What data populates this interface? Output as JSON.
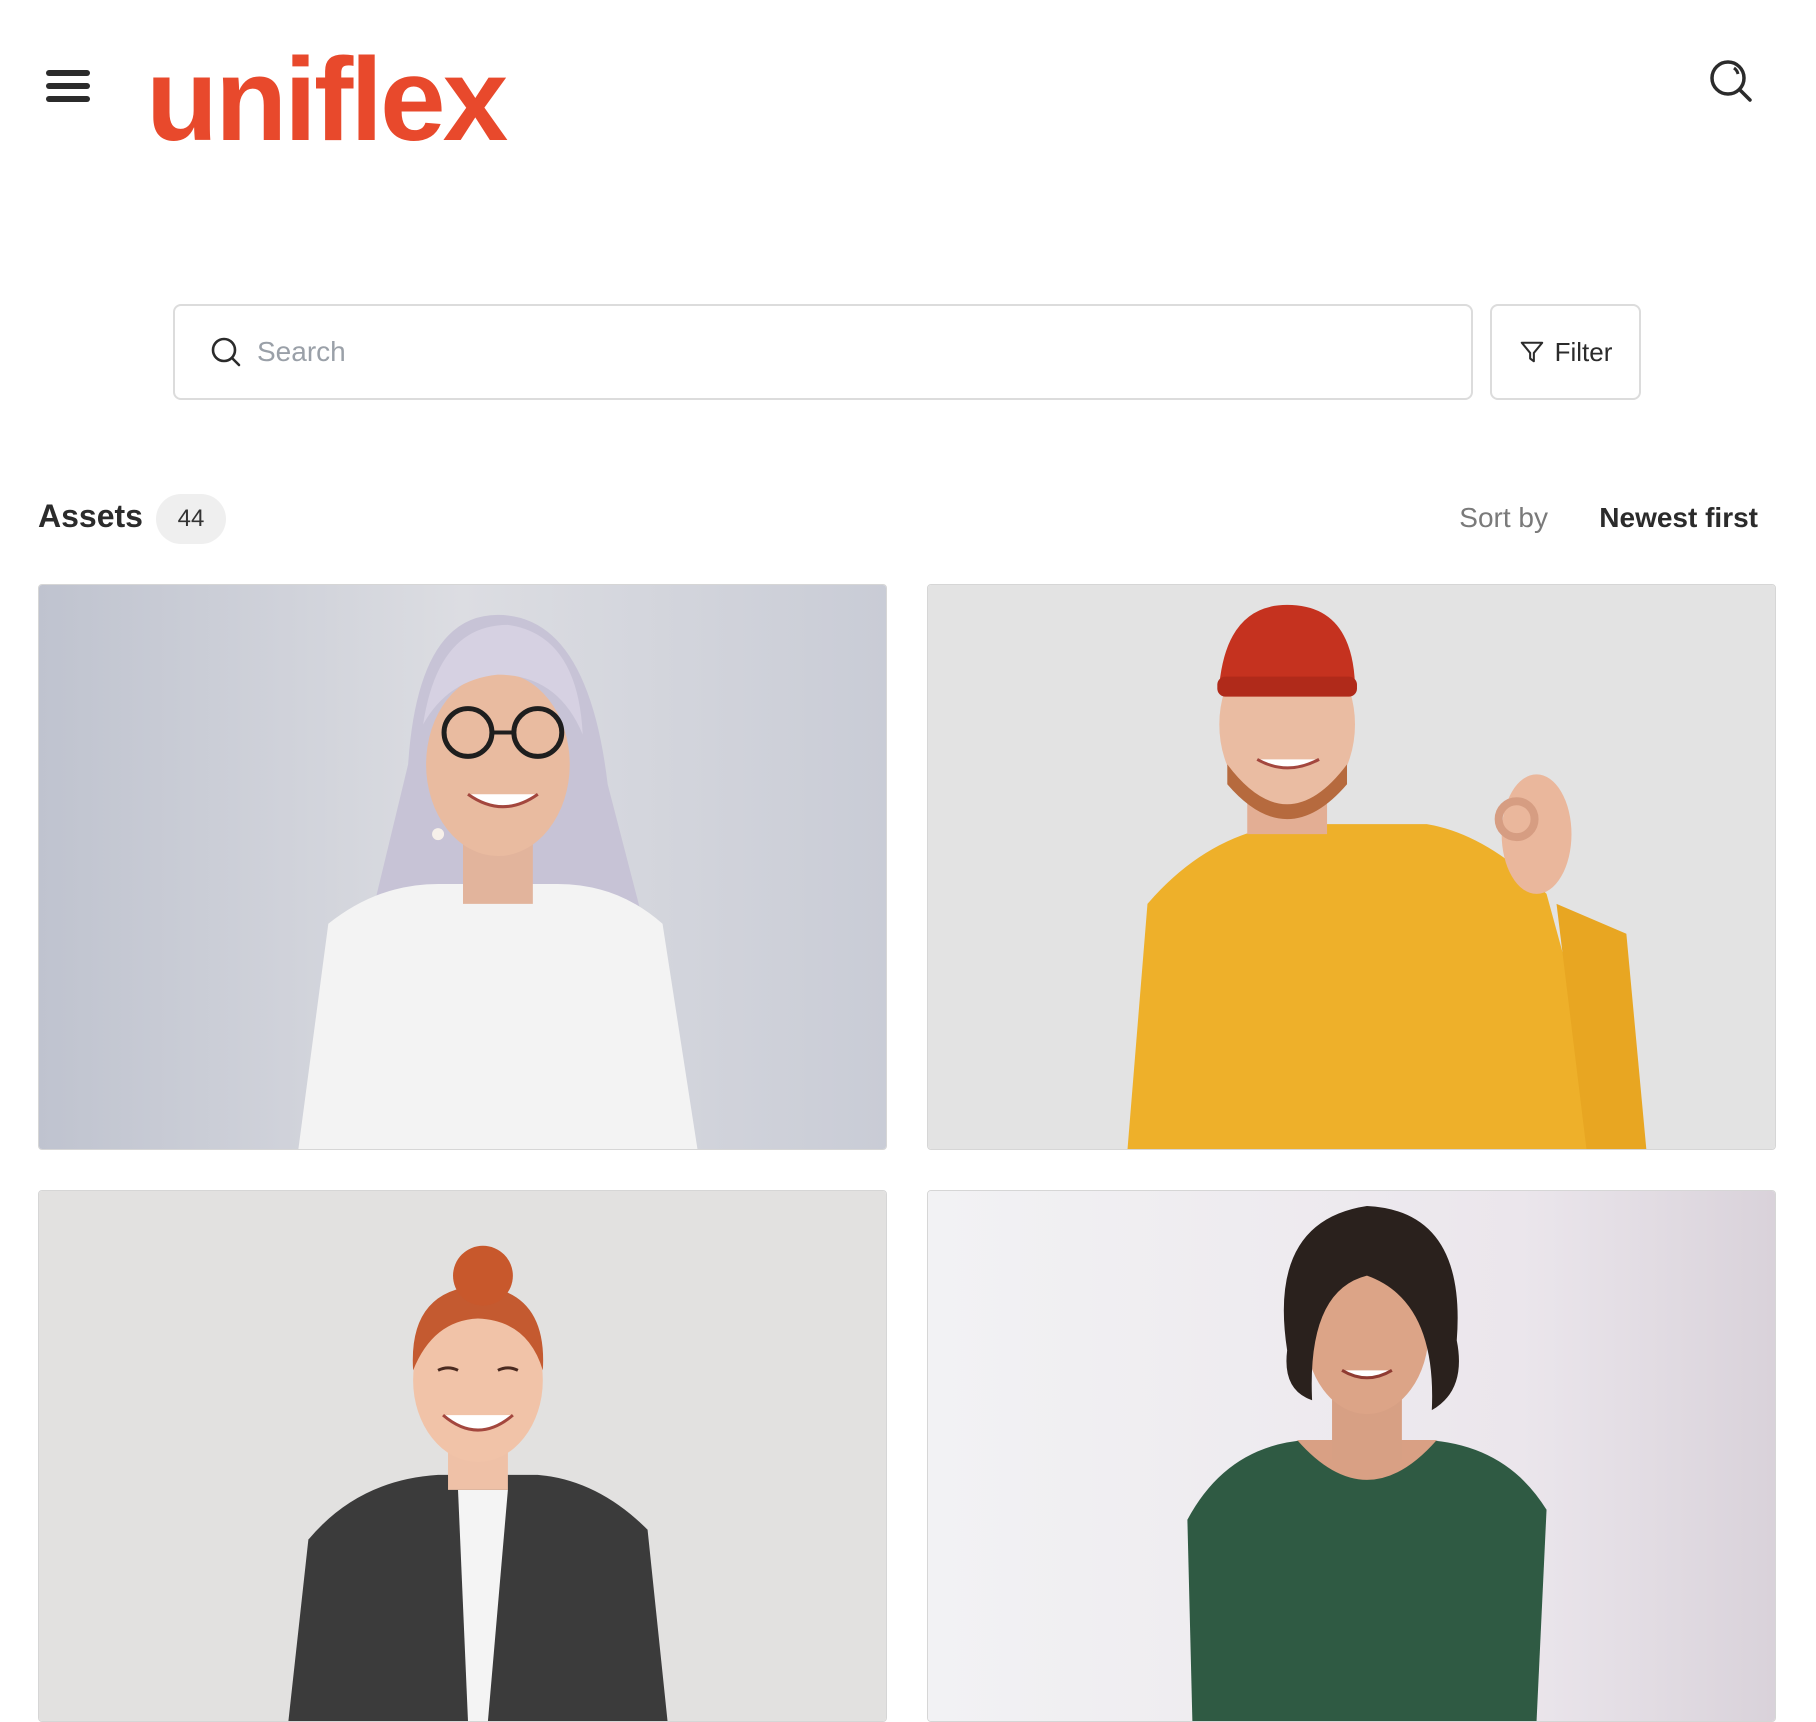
{
  "header": {
    "logo_text": "uniflex",
    "brand_color": "#e8492c",
    "menu_icon": "hamburger-icon",
    "search_icon": "search-icon"
  },
  "search": {
    "placeholder": "Search",
    "value": ""
  },
  "filter": {
    "label": "Filter",
    "icon": "filter-icon"
  },
  "assets": {
    "title": "Assets",
    "count": "44",
    "sort_label": "Sort by",
    "sort_value": "Newest first"
  }
}
